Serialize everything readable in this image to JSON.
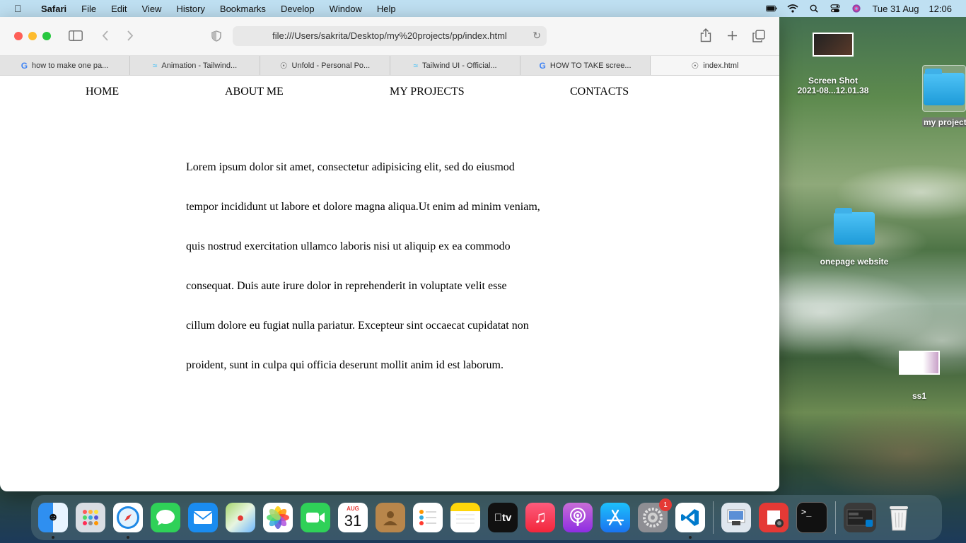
{
  "menubar": {
    "app": "Safari",
    "items": [
      "File",
      "Edit",
      "View",
      "History",
      "Bookmarks",
      "Develop",
      "Window",
      "Help"
    ],
    "date": "Tue 31 Aug",
    "time": "12:06"
  },
  "browser": {
    "url": "file:///Users/sakrita/Desktop/my%20projects/pp/index.html",
    "tabs": [
      {
        "label": "how to make one pa...",
        "icon": "google-icon"
      },
      {
        "label": "Animation - Tailwind...",
        "icon": "tailwind-icon"
      },
      {
        "label": "Unfold - Personal Po...",
        "icon": "compass-icon"
      },
      {
        "label": "Tailwind UI - Official...",
        "icon": "tailwind-icon"
      },
      {
        "label": "HOW TO TAKE scree...",
        "icon": "google-icon"
      },
      {
        "label": "index.html",
        "icon": "compass-icon"
      }
    ]
  },
  "page": {
    "nav": [
      "HOME",
      "ABOUT ME",
      "MY PROJECTS",
      "CONTACTS"
    ],
    "paragraph": [
      "Lorem ipsum dolor sit amet, consectetur adipisicing elit, sed do eiusmod",
      "tempor incididunt ut labore et dolore magna aliqua.Ut enim ad minim veniam,",
      "quis nostrud exercitation ullamco laboris nisi ut aliquip ex ea commodo",
      "consequat. Duis aute irure dolor in reprehenderit in voluptate velit esse",
      "cillum dolore eu fugiat nulla pariatur. Excepteur sint occaecat cupidatat non",
      "proident, sunt in culpa qui officia deserunt mollit anim id est laborum."
    ]
  },
  "desktop": {
    "items": [
      {
        "label_line1": "Screen Shot",
        "label_line2": "2021-08...12.01.38"
      },
      {
        "label": "my project"
      },
      {
        "label": "onepage website"
      },
      {
        "label": "ss1"
      }
    ]
  },
  "dock": {
    "calendar_month": "AUG",
    "calendar_day": "31",
    "settings_badge": "1",
    "tv_label": "tv"
  }
}
